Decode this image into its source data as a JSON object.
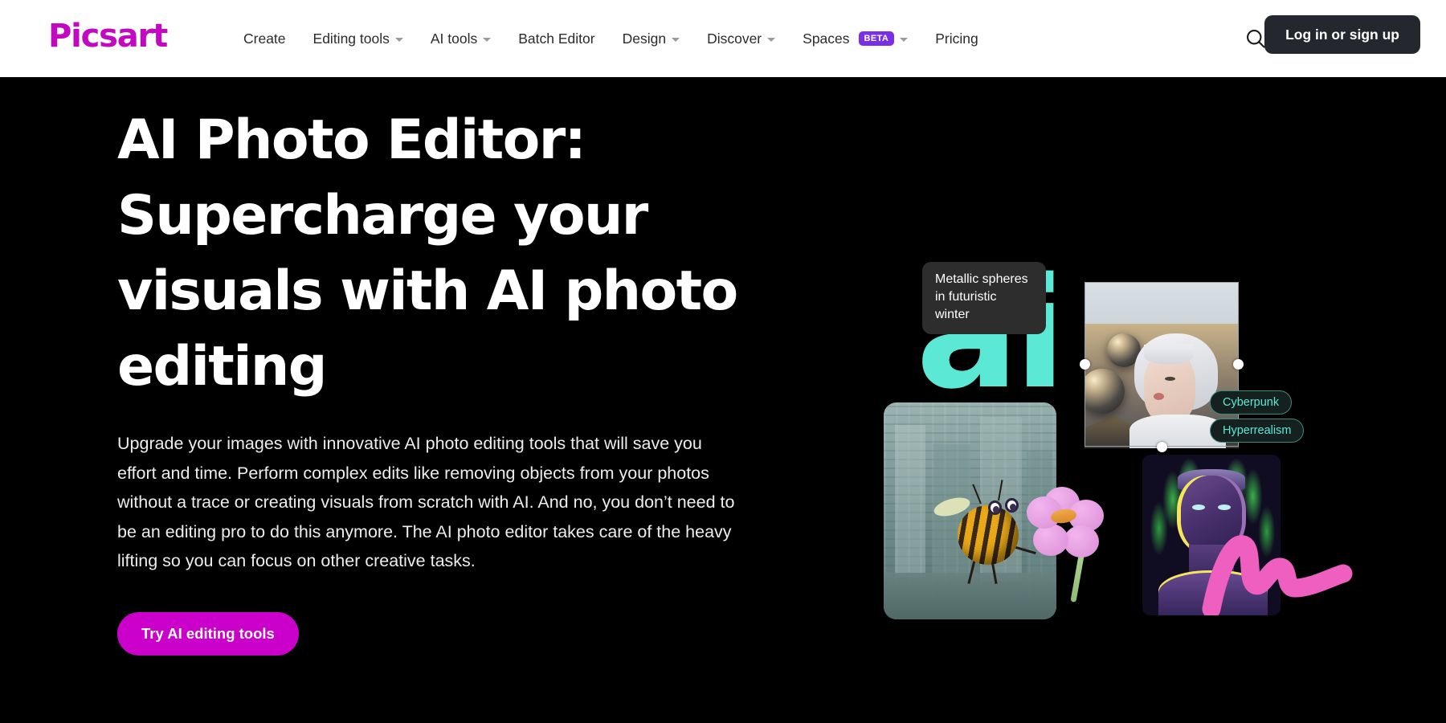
{
  "header": {
    "logo_text": "Picsart",
    "logo_color": "#C209C1",
    "nav": [
      {
        "label": "Create",
        "has_caret": false,
        "badge": null
      },
      {
        "label": "Editing tools",
        "has_caret": true,
        "badge": null
      },
      {
        "label": "AI tools",
        "has_caret": true,
        "badge": null
      },
      {
        "label": "Batch Editor",
        "has_caret": false,
        "badge": null
      },
      {
        "label": "Design",
        "has_caret": true,
        "badge": null
      },
      {
        "label": "Discover",
        "has_caret": true,
        "badge": null
      },
      {
        "label": "Spaces",
        "has_caret": true,
        "badge": "BETA"
      },
      {
        "label": "Pricing",
        "has_caret": false,
        "badge": null
      }
    ],
    "search_icon": "search-icon",
    "login_label": "Log in or sign up",
    "login_bg": "#25272E",
    "badge_color": "#7A2EE6"
  },
  "hero": {
    "headline": "AI Photo Editor: Supercharge your visuals with AI photo editing",
    "paragraph": "Upgrade your images with innovative AI photo editing tools that will save you effort and time. Perform complex edits like removing objects from your photos without a trace or creating visuals from scratch with AI. And no, you don’t need to be an editing pro to do this anymore. The AI photo editor takes care of the heavy lifting so you can focus on other creative tasks.",
    "cta_label": "Try AI editing tools",
    "cta_color": "#CB00CB",
    "background": "#000000"
  },
  "collage": {
    "ai_mark": "ai",
    "ai_mark_color": "#5BE8D4",
    "tooltip_text": "Metallic spheres in futuristic winter",
    "tags": [
      {
        "label": "Cyberpunk"
      },
      {
        "label": "Hyperrealism"
      }
    ],
    "tag_color": "#5BE8D4",
    "images": [
      {
        "name": "bee-cityscape-image",
        "caption": ""
      },
      {
        "name": "woman-spheres-image",
        "caption": ""
      },
      {
        "name": "neon-portrait-image",
        "caption": ""
      },
      {
        "name": "pink-flower-image",
        "caption": ""
      }
    ],
    "brush_color": "#EE5FC0"
  }
}
